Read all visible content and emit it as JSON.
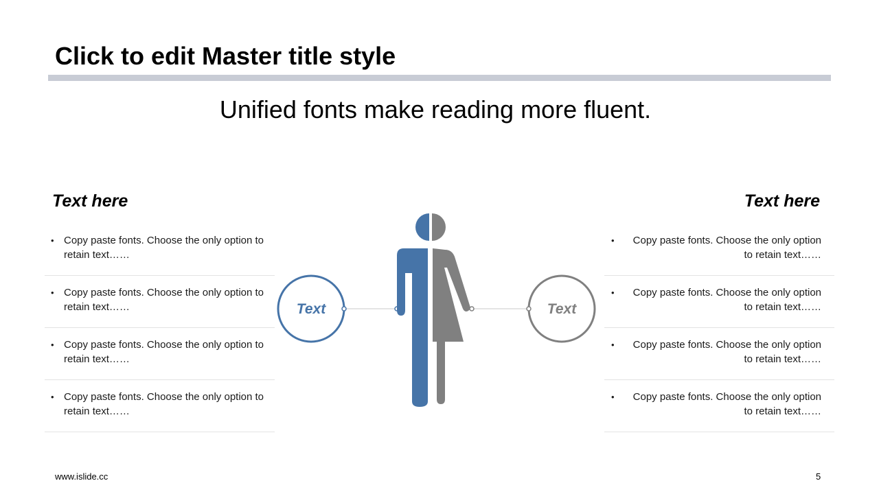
{
  "slide": {
    "title": "Click to edit Master title style",
    "subtitle": "Unified fonts make reading more fluent."
  },
  "left": {
    "heading": "Text here",
    "items": [
      "Copy paste fonts. Choose the only option to retain text……",
      "Copy paste fonts. Choose the only option to retain text……",
      "Copy paste fonts. Choose the only option to retain text……",
      "Copy paste fonts. Choose the only option to retain text……"
    ]
  },
  "right": {
    "heading": "Text here",
    "items": [
      "Copy paste fonts. Choose the only option to retain text……",
      "Copy paste fonts. Choose the only option to retain text……",
      "Copy paste fonts. Choose the only option to retain text……",
      "Copy paste fonts. Choose the only option to retain text……"
    ]
  },
  "figure": {
    "left_label": "Text",
    "right_label": "Text",
    "icon": "male-female-split-icon"
  },
  "colors": {
    "blue": "#4674a8",
    "gray": "#808080",
    "rule": "#c8ccd5"
  },
  "footer": {
    "url": "www.islide.cc",
    "page": "5"
  }
}
